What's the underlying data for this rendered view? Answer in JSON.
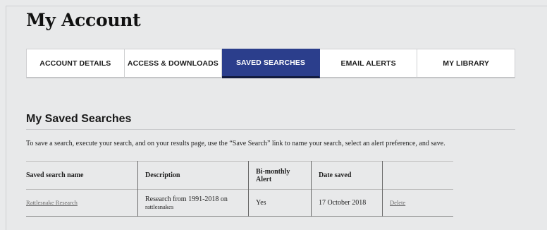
{
  "page": {
    "title": "My Account"
  },
  "tabs": [
    {
      "label": "ACCOUNT DETAILS",
      "active": false
    },
    {
      "label": "ACCESS & DOWNLOADS",
      "active": false
    },
    {
      "label": "SAVED SEARCHES",
      "active": true
    },
    {
      "label": "EMAIL ALERTS",
      "active": false
    },
    {
      "label": "MY LIBRARY",
      "active": false
    }
  ],
  "section": {
    "title": "My Saved Searches",
    "intro": "To save a search, execute your search, and on your results page, use the “Save Search” link to name your search, select an alert preference, and save."
  },
  "table": {
    "headers": [
      "Saved search name",
      "Description",
      "Bi-monthly Alert",
      "Date saved",
      ""
    ],
    "rows": [
      {
        "name": "Rattlesnake Research",
        "description_line1": "Research from 1991-2018 on",
        "description_line2": "rattlesnakes",
        "alert": "Yes",
        "date": "17 October 2018",
        "action": "Delete"
      }
    ]
  },
  "colors": {
    "active_tab": "#2b3e8c",
    "background": "#e8e9ea"
  }
}
